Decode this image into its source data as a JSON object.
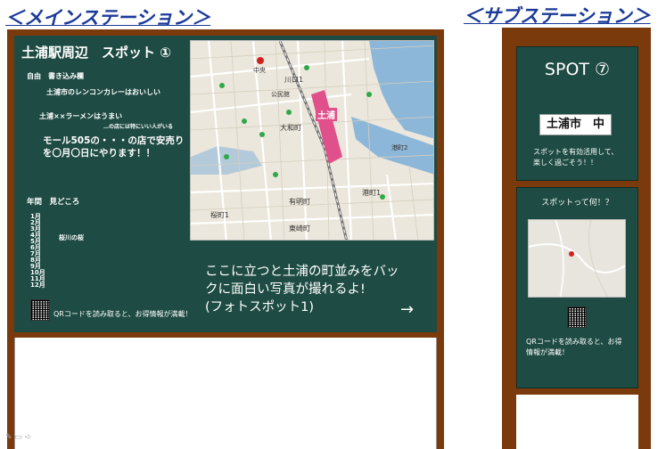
{
  "labels": {
    "main_station": "＜メインステーション＞",
    "sub_station": "＜サブステーション＞"
  },
  "main": {
    "heading": "土浦駅周辺　スポット ①",
    "free_title": "自由　書き込み欄",
    "free_lines": [
      "土浦市のレンコンカレーはおいしい",
      "土浦××ラーメンはうまい",
      "…の店には特にいい人がいる",
      "モール505の・・・の店で安売り",
      "を〇月〇日にやります！！"
    ],
    "season_title": "年間　見どころ",
    "months": [
      "1月",
      "2月",
      "3月",
      "4月",
      "5月",
      "6月",
      "7月",
      "8月",
      "9月",
      "10月",
      "11月",
      "12月"
    ],
    "month_note": "桜川の桜",
    "qr_text": "QRコードを読み取ると、お得情報が満載！",
    "caption": [
      "ここに立つと土浦の町並みをバッ",
      "クに面白い写真が撮れるよ!",
      "(フォトスポット1)"
    ],
    "arrow": "→",
    "map": {
      "station_label": "土浦",
      "places": [
        "川口1",
        "大和町",
        "港町1",
        "桜町1",
        "有明町",
        "東崎町",
        "中央",
        "公民館",
        "港町2"
      ]
    }
  },
  "sub": {
    "spot_number": "SPOT ⑦",
    "place": "土浦市　中",
    "desc": [
      "スポットを有効活用して、",
      "楽しく過ごそう！！"
    ],
    "question": "スポットって何！？",
    "qr_text": [
      "QRコードを読み取ると、お得",
      "情報が満載！"
    ]
  },
  "colors": {
    "board": "#1e4b43",
    "frame": "#7a3a0c",
    "title": "#1b3a9a"
  }
}
